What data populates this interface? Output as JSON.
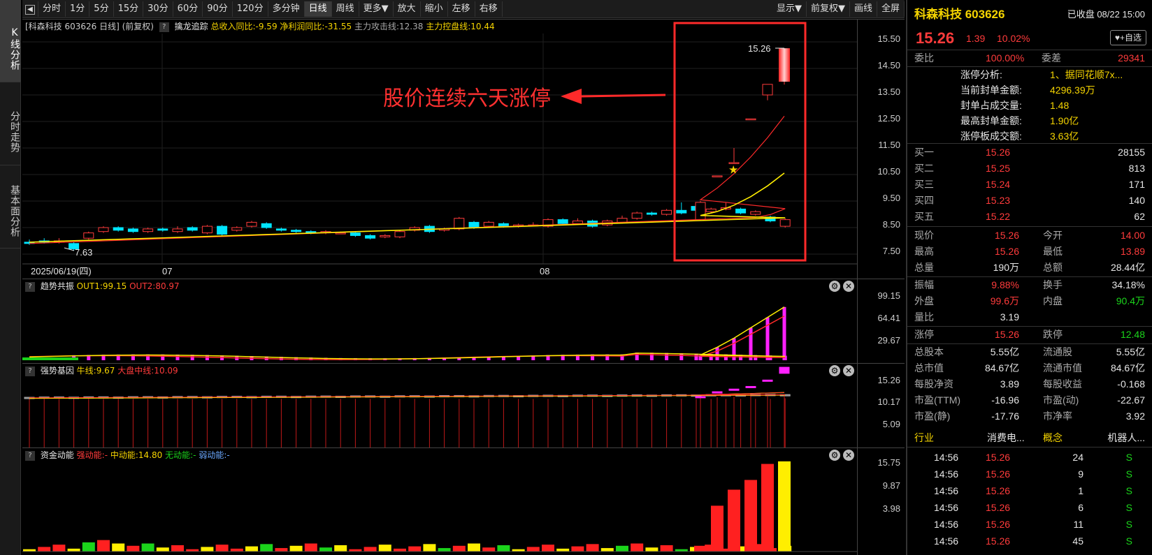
{
  "sidebar": {
    "tabs": [
      {
        "label": "K线分析",
        "active": true
      },
      {
        "label": "分时走势",
        "active": false
      },
      {
        "label": "基本面分析",
        "active": false
      }
    ]
  },
  "toolbar": {
    "left_buttons": [
      "分时",
      "1分",
      "5分",
      "15分",
      "30分",
      "60分",
      "90分",
      "120分",
      "多分钟",
      "日线",
      "周线",
      "更多▼",
      "放大",
      "缩小",
      "左移",
      "右移"
    ],
    "active_index": 9,
    "right_buttons": [
      "显示▼",
      "前复权▼",
      "画线",
      "全屏"
    ]
  },
  "main_chart": {
    "header": {
      "title": "[科森科技 603626 日线] (前复权)",
      "indicator": "擒龙追踪",
      "rev": "总收入同比:-9.59",
      "profit": "净利润同比:-31.55",
      "attack": "主力攻击线:12.38",
      "control": "主力控盘线:10.44"
    },
    "y_ticks": [
      "15.50",
      "14.50",
      "13.50",
      "12.50",
      "11.50",
      "10.50",
      "9.50",
      "8.50",
      "7.50"
    ],
    "date_labels": [
      "2025/06/19(四)",
      "07",
      "08"
    ],
    "high_label": "15.26",
    "low_label": "7.63",
    "annotation": "股价连续六天涨停",
    "colors": {
      "up": "#ff3b3b",
      "down": "#00e5ff",
      "ma_fast": "#ff2a2a",
      "ma_slow": "#ffee00"
    }
  },
  "pane_trend": {
    "name": "趋势共振",
    "out1": "OUT1:99.15",
    "out2": "OUT2:80.97",
    "y_ticks": [
      "99.15",
      "64.41",
      "29.67"
    ]
  },
  "pane_strong": {
    "name": "强势基因",
    "bull": "牛线:9.67",
    "market": "大盘中线:10.09",
    "y_ticks": [
      "15.26",
      "10.17",
      "5.09"
    ]
  },
  "pane_fund": {
    "name": "资金动能",
    "strong": "强动能:-",
    "mid": "中动能:14.80",
    "none": "无动能:-",
    "weak": "弱动能:-",
    "y_ticks": [
      "15.75",
      "9.87",
      "3.98"
    ]
  },
  "quote": {
    "name": "科森科技 603626",
    "status": "已收盘 08/22 15:00",
    "price": "15.26",
    "change": "1.39",
    "pct": "10.02%",
    "watch_label": "+自选",
    "weibi_label": "委比",
    "weibi": "100.00%",
    "weicha_label": "委差",
    "weicha": "29341",
    "limit_info": [
      {
        "label": "涨停分析:",
        "value": "1、据同花顺7x..."
      },
      {
        "label": "当前封单金额:",
        "value": "4296.39万"
      },
      {
        "label": "封单占成交量:",
        "value": "1.48"
      },
      {
        "label": "最高封单金额:",
        "value": "1.90亿"
      },
      {
        "label": "涨停板成交额:",
        "value": "3.63亿"
      }
    ],
    "bids": [
      {
        "label": "买一",
        "price": "15.26",
        "vol": "28155"
      },
      {
        "label": "买二",
        "price": "15.25",
        "vol": "813"
      },
      {
        "label": "买三",
        "price": "15.24",
        "vol": "171"
      },
      {
        "label": "买四",
        "price": "15.23",
        "vol": "140"
      },
      {
        "label": "买五",
        "price": "15.22",
        "vol": "62"
      }
    ],
    "stats": [
      {
        "l1": "现价",
        "v1": "15.26",
        "c1": "red",
        "l2": "今开",
        "v2": "14.00",
        "c2": "red"
      },
      {
        "l1": "最高",
        "v1": "15.26",
        "c1": "red",
        "l2": "最低",
        "v2": "13.89",
        "c2": "red"
      },
      {
        "l1": "总量",
        "v1": "190万",
        "c1": "white",
        "l2": "总额",
        "v2": "28.44亿",
        "c2": "white"
      },
      {
        "l1": "振幅",
        "v1": "9.88%",
        "c1": "red",
        "l2": "换手",
        "v2": "34.18%",
        "c2": "white"
      },
      {
        "l1": "外盘",
        "v1": "99.6万",
        "c1": "red",
        "l2": "内盘",
        "v2": "90.4万",
        "c2": "green"
      },
      {
        "l1": "量比",
        "v1": "3.19",
        "c1": "white",
        "l2": "",
        "v2": "",
        "c2": "white"
      },
      {
        "l1": "涨停",
        "v1": "15.26",
        "c1": "red",
        "l2": "跌停",
        "v2": "12.48",
        "c2": "green"
      },
      {
        "l1": "总股本",
        "v1": "5.55亿",
        "c1": "white",
        "l2": "流通股",
        "v2": "5.55亿",
        "c2": "white"
      },
      {
        "l1": "总市值",
        "v1": "84.67亿",
        "c1": "white",
        "l2": "流通市值",
        "v2": "84.67亿",
        "c2": "white"
      },
      {
        "l1": "每股净资",
        "v1": "3.89",
        "c1": "white",
        "l2": "每股收益",
        "v2": "-0.168",
        "c2": "white"
      },
      {
        "l1": "市盈(TTM)",
        "v1": "-16.96",
        "c1": "white",
        "l2": "市盈(动)",
        "v2": "-22.67",
        "c2": "white"
      },
      {
        "l1": "市盈(静)",
        "v1": "-17.76",
        "c1": "white",
        "l2": "市净率",
        "v2": "3.92",
        "c2": "white"
      }
    ],
    "industry_label": "行业",
    "industry": "消费电...",
    "concept_label": "概念",
    "concept": "机器人...",
    "ticks": [
      {
        "time": "14:56",
        "price": "15.26",
        "vol": "24",
        "side": "S"
      },
      {
        "time": "14:56",
        "price": "15.26",
        "vol": "9",
        "side": "S"
      },
      {
        "time": "14:56",
        "price": "15.26",
        "vol": "1",
        "side": "S"
      },
      {
        "time": "14:56",
        "price": "15.26",
        "vol": "6",
        "side": "S"
      },
      {
        "time": "14:56",
        "price": "15.26",
        "vol": "11",
        "side": "S"
      },
      {
        "time": "14:56",
        "price": "15.26",
        "vol": "45",
        "side": "S"
      }
    ]
  }
}
